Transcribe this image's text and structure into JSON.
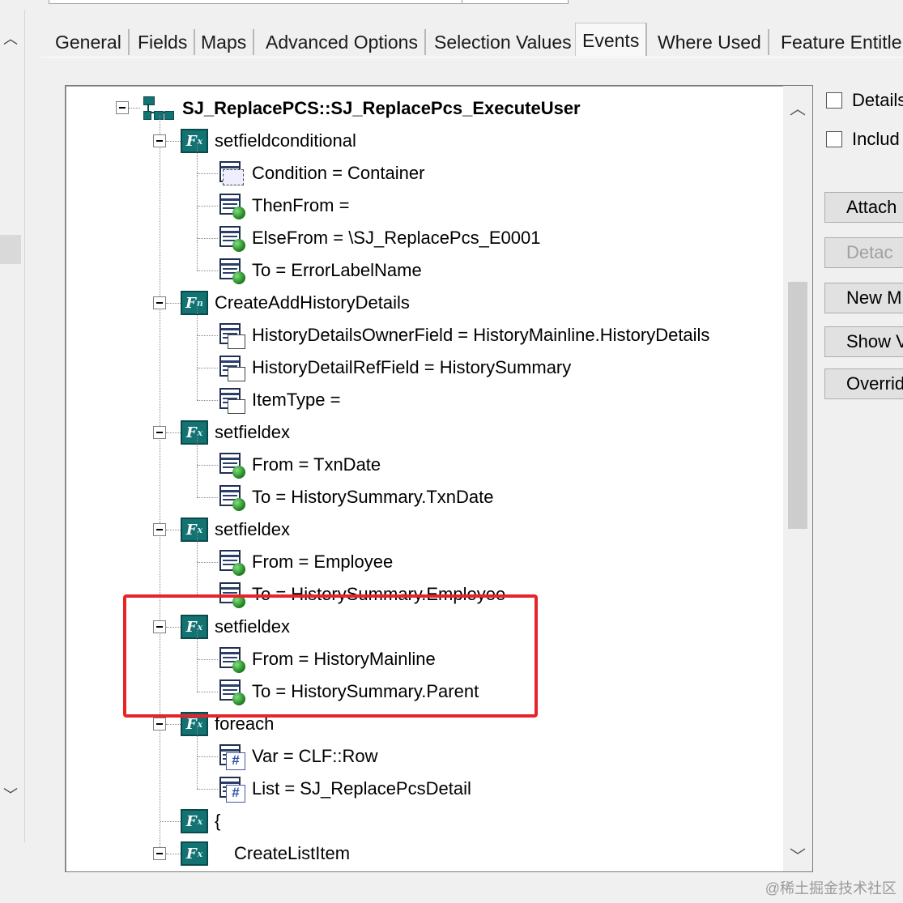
{
  "tabs": [
    "General",
    "Fields",
    "Maps",
    "Advanced Options",
    "Selection Values",
    "Events",
    "Where Used",
    "Feature Entitlem"
  ],
  "active_tab": "Events",
  "tree": {
    "root": "SJ_ReplacePCS::SJ_ReplacePcs_ExecuteUser",
    "rows": [
      {
        "label": "setfieldconditional",
        "icon": "function-icon"
      },
      {
        "label": "Condition = Container",
        "icon": "container-param-icon"
      },
      {
        "label": "ThenFrom =",
        "icon": "field-param-icon"
      },
      {
        "label": "ElseFrom = \\SJ_ReplacePcs_E0001",
        "icon": "field-param-icon"
      },
      {
        "label": "To = ErrorLabelName",
        "icon": "field-param-icon"
      },
      {
        "label": "CreateAddHistoryDetails",
        "icon": "function-icon"
      },
      {
        "label": "HistoryDetailsOwnerField = HistoryMainline.HistoryDetails",
        "icon": "window-param-icon"
      },
      {
        "label": "HistoryDetailRefField = HistorySummary",
        "icon": "window-param-icon"
      },
      {
        "label": "ItemType =",
        "icon": "window-param-icon"
      },
      {
        "label": "setfieldex",
        "icon": "function-icon"
      },
      {
        "label": "From = TxnDate",
        "icon": "field-param-icon"
      },
      {
        "label": "To = HistorySummary.TxnDate",
        "icon": "field-param-icon"
      },
      {
        "label": "setfieldex",
        "icon": "function-icon"
      },
      {
        "label": "From = Employee",
        "icon": "field-param-icon"
      },
      {
        "label": "To = HistorySummary.Employee",
        "icon": "field-param-icon"
      },
      {
        "label": "setfieldex",
        "icon": "function-icon"
      },
      {
        "label": "From = HistoryMainline",
        "icon": "field-param-icon"
      },
      {
        "label": "To = HistorySummary.Parent",
        "icon": "field-param-icon"
      },
      {
        "label": "foreach",
        "icon": "function-icon"
      },
      {
        "label": "Var = CLF::Row",
        "icon": "hash-param-icon"
      },
      {
        "label": "List = SJ_ReplacePcsDetail",
        "icon": "hash-param-icon"
      },
      {
        "label": "{",
        "icon": "function-icon"
      },
      {
        "label": "CreateListItem",
        "icon": "function-icon"
      }
    ]
  },
  "right_panel": {
    "checkboxes": [
      "Details",
      "Includ"
    ],
    "buttons": [
      {
        "label": "Attach",
        "enabled": true
      },
      {
        "label": "Detac",
        "enabled": false
      },
      {
        "label": "New M",
        "enabled": true
      },
      {
        "label": "Show V",
        "enabled": true
      },
      {
        "label": "Override",
        "enabled": true
      }
    ]
  },
  "watermark": "@稀土掘金技术社区",
  "colors": {
    "highlight": "#e8232a",
    "function_icon": "#137272"
  }
}
